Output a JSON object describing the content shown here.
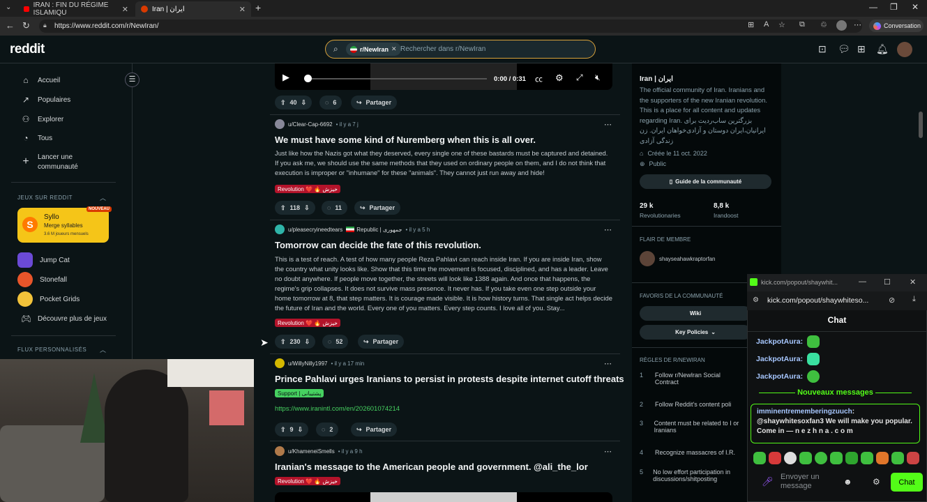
{
  "browser": {
    "tabs": [
      {
        "label": "IRAN : FIN DU RÉGIME ISLAMIQU"
      },
      {
        "label": "Iran | ایران"
      }
    ],
    "url": "https://www.reddit.com/r/NewIran/",
    "conversation_label": "Conversation"
  },
  "header": {
    "logo": "reddit",
    "search_chip": "r/NewIran",
    "search_placeholder": "Rechercher dans r/NewIran"
  },
  "leftnav": {
    "items": [
      "Accueil",
      "Populaires",
      "Explorer",
      "Tous"
    ],
    "create_line1": "Lancer une",
    "create_line2": "communauté",
    "games_section": "JEUX SUR REDDIT",
    "syllo_title": "Syllo",
    "syllo_sub": "Merge syllables",
    "syllo_players": "3.6 M joueurs mensuels",
    "new_badge": "NOUVEAU",
    "games": [
      "Jump Cat",
      "Stonefall",
      "Pocket Grids",
      "Découvre plus de jeux"
    ],
    "custom_section": "FLUX PERSONNALISÉS"
  },
  "video": {
    "time": "0:00 / 0:31",
    "progress": 0.0
  },
  "actions_top": {
    "votes": "40",
    "comments": "6",
    "share": "Partager"
  },
  "posts": [
    {
      "author": "u/Clear-Cap-6692",
      "time": "il y a 7 j",
      "title": "We must have some kind of Nuremberg when this is all over.",
      "body": "Just like how the Nazis got what they deserved, every single one of these bastards must be captured and detained. If you ask me, we should use the same methods that they used on ordinary people on them, and I do not think that execution is improper or \"inhumane\" for these \"animals\". They cannot just run away and hide!",
      "flair": "Revolution ❤️ 🔥 خیزش",
      "votes": "118",
      "comments": "11",
      "share": "Partager"
    },
    {
      "author": "u/pleasecryineedtears",
      "user_flair": "Republic | جمهوری",
      "time": "il y a 5 h",
      "title": "Tomorrow can decide the fate of this revolution.",
      "body": "This is a test of reach. A test of how many people Reza Pahlavi can reach inside Iran. If you are inside Iran, show the country what unity looks like. Show that this time the movement is focused, disciplined, and has a leader. Leave no doubt anywhere. If people move together, the streets will look like 1388 again. And once that happens, the regime's grip collapses. It does not survive mass presence. It never has. If you take even one step outside your home tomorrow at 8, that step matters. It is courage made visible. It is how history turns. That single act helps decide the future of Iran and the world. Every one of you matters. Every step counts. I love all of you. Stay...",
      "flair": "Revolution ❤️ 🔥 خیزش",
      "votes": "230",
      "comments": "52",
      "share": "Partager"
    },
    {
      "author": "u/WillyNilly1997",
      "time": "il y a 17 min",
      "title": "Prince Pahlavi urges Iranians to persist in protests despite internet cutoff threats",
      "flair": "Support | پشتیبانی",
      "link": "https://www.iranintl.com/en/202601074214",
      "votes": "9",
      "comments": "2",
      "share": "Partager"
    },
    {
      "author": "u/KhameneiSmells",
      "time": "il y a 9 h",
      "title": "Iranian's message to the American people and government. @ali_the_lor",
      "flair": "Revolution ❤️ 🔥 خیزش"
    }
  ],
  "community": {
    "name": "Iran | ایران",
    "description": "The official community of Iran. Iranians and the supporters of the new Iranian revolution. This is a place for all content and updates regarding Iran. بزرگترین ساب‌ردیت برای ایرانیان،ایران دوستان و آزادی‌خواهان ایران. زن زندگی آزادی",
    "created": "Créée le 11 oct. 2022",
    "visibility": "Public",
    "guide_button": "Guide de la communauté",
    "members": "29 k",
    "members_label": "Revolutionaries",
    "online": "8,8 k",
    "online_label": "Irandoost",
    "member_flair_title": "FLAIR DE MEMBRE",
    "member_flair_user": "shayseahawkraptorfan",
    "bookmarks_title": "FAVORIS DE LA COMMUNAUTÉ",
    "bookmark_wiki": "Wiki",
    "bookmark_policies": "Key Policies",
    "rules_title": "RÈGLES DE R/NEWIRAN",
    "rules": [
      {
        "n": "1",
        "text": "Follow r/Newlran Social Contract"
      },
      {
        "n": "2",
        "text": "Follow Reddit's content poli"
      },
      {
        "n": "3",
        "text": "Content must be related to I or Iranians"
      },
      {
        "n": "4",
        "text": "Recognize massacres of I.R."
      },
      {
        "n": "5",
        "text": "No low effort participation in discussions/shitposting"
      }
    ]
  },
  "kick": {
    "window_title": "kick.com/popout/shaywhit...",
    "url": "kick.com/popout/shaywhiteso...",
    "chat_title": "Chat",
    "lines": [
      "JackpotAura:",
      "JackpotAura:",
      "JackpotAura:"
    ],
    "new_messages": "Nouveaux messages",
    "msg_user": "imminentrememberingzuuch",
    "msg_text": "@shaywhitesoxfan3 We will make you popular. Come in — n e z h n a . c o m",
    "input_placeholder": "Envoyer un message",
    "chat_button": "Chat"
  },
  "colors": {
    "accent_kick": "#53fc18",
    "flair_red": "#b3132a",
    "flair_green": "#46d160",
    "search_border": "#d9a23a"
  }
}
